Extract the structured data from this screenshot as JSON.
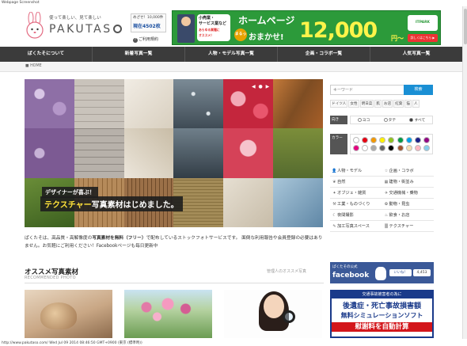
{
  "window": {
    "caption": "Webpage Screenshot"
  },
  "header": {
    "tagline": "使って楽しい、見て楽しい",
    "logo_text": "PAKUTAS",
    "counter_line1": "めざせ！10,000件",
    "counter_line2": "現在4502枚",
    "help_link": "ご利用規約"
  },
  "banner": {
    "bubble_line1": "小売業・",
    "bubble_line2": "サービス業など",
    "bubble_line3": "あらゆる業種に",
    "bubble_line4": "オススメ！",
    "headline": "ホームページ",
    "maru": "まるっ",
    "omakase": "おまかせ!",
    "price": "12,000",
    "yen": "円〜",
    "brand": "ITPARK",
    "detail": "詳しくはこちら ▶"
  },
  "nav": {
    "items": [
      {
        "label": "ぱくたそについて"
      },
      {
        "label": "新着写真一覧"
      },
      {
        "label": "人物・モデル写真一覧"
      },
      {
        "label": "企画・コラボ一覧"
      },
      {
        "label": "人気写真一覧"
      }
    ]
  },
  "breadcrumb": {
    "home": "HOME"
  },
  "hero": {
    "caption1": "デザイナーが喜ぶ！",
    "caption2_em": "テクスチャー",
    "caption2_rest": "写真素材はじめました。",
    "dots": "◀ ● ▶"
  },
  "intro": {
    "part1": "ぱくたそは、高品質・高解像度の",
    "em": "写真素材を無料（フリー）",
    "part2": "で配布しているストックフォトサービスです。 面倒な利用報告や会員登録の必要はありません。お気軽にご利用ください！Facebookページも毎日更新中"
  },
  "recommended": {
    "title": "オススメ写真素材",
    "subtitle": "RECOMMENDED PHOTO",
    "link": "管理人のオススメ写真"
  },
  "search": {
    "placeholder": "キーワード",
    "button": "検索",
    "filters": [
      "ドイツ人",
      "女性",
      "明日菜",
      "肌",
      "お店",
      "紅葉",
      "猫",
      "人"
    ]
  },
  "orientation": {
    "label": "向き",
    "options": [
      {
        "label": "ヨコ",
        "checked": false
      },
      {
        "label": "タテ",
        "checked": false
      },
      {
        "label": "すべて",
        "checked": true
      }
    ]
  },
  "colors": {
    "label": "カラー",
    "swatches": [
      "#ffffff",
      "#e60012",
      "#f39800",
      "#fff100",
      "#8fc31f",
      "#009944",
      "#00a0e9",
      "#1d2088",
      "#920783",
      "#e4007f",
      "#ffffff",
      "#aaaaaa",
      "#666666",
      "#000000",
      "#a0522d",
      "#f5deb3",
      "#ffb6c1",
      "#87ceeb"
    ]
  },
  "categories": [
    {
      "left": "人物・モデル",
      "left_icon": "person-icon",
      "right": "企画・コラボ",
      "right_icon": "star-icon"
    },
    {
      "left": "自然",
      "left_icon": "leaf-icon",
      "right": "建物・街並み",
      "right_icon": "building-icon"
    },
    {
      "left": "オブジェ・雑貨",
      "left_icon": "object-icon",
      "right": "交通機械・乗物",
      "right_icon": "vehicle-icon"
    },
    {
      "left": "工業・ものづくり",
      "left_icon": "tool-icon",
      "right": "動物・昆虫",
      "right_icon": "animal-icon"
    },
    {
      "left": "夜間撮影",
      "left_icon": "moon-icon",
      "right": "飲食・お店",
      "right_icon": "food-icon"
    },
    {
      "left": "加工写真スペース",
      "left_icon": "edit-icon",
      "right": "テクスチャー",
      "right_icon": "texture-icon"
    }
  ],
  "facebook": {
    "small": "ぱくたその公式",
    "big": "facebook",
    "like": "いいね！",
    "count": "4,453"
  },
  "ad": {
    "head": "交通事故被害者の為に",
    "line1": "後遺症・死亡事故損害額",
    "line2": "無料シミュレーションソフト",
    "line3": "慰謝料を自動計算"
  },
  "status": {
    "text": "http://www.pakutaso.com/  Wed Jul 09 2014 08:46:50 GMT+0900 (東京 (標準時))"
  }
}
